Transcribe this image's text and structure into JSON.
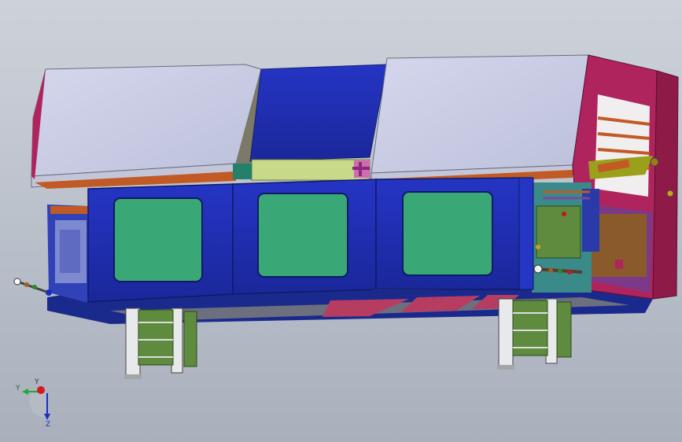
{
  "viewport": {
    "background_top": "#cdd2da",
    "background_bottom": "#a9b0bc"
  },
  "colors": {
    "top_cover": "#c7cbe2",
    "center_cover": "#1f2fb8",
    "front_panel": "#1e2ea9",
    "window_green": "#3aa876",
    "frame_red": "#b0245e",
    "trim_orange": "#c15a24",
    "leg_gray": "#a3a6a9",
    "module_olive": "#5e8b3e",
    "yellow_green": "#c9d98a"
  },
  "axes": {
    "x_label": "",
    "y_label": "Y",
    "z_label": "Z",
    "y_color": "#22a83a",
    "z_color": "#1a2fc9",
    "x_color": "#d41a1a"
  }
}
